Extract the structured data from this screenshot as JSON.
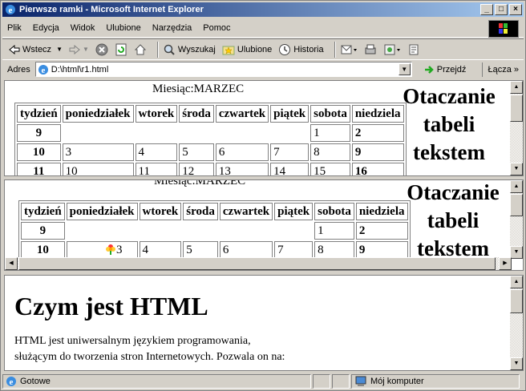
{
  "window": {
    "title": "Pierwsze ramki - Microsoft Internet Explorer",
    "min": "_",
    "max": "□",
    "close": "×"
  },
  "menu": [
    "Plik",
    "Edycja",
    "Widok",
    "Ulubione",
    "Narzędzia",
    "Pomoc"
  ],
  "toolbar": {
    "back": "Wstecz",
    "search": "Wyszukaj",
    "favorites": "Ulubione",
    "history": "Historia"
  },
  "address": {
    "label": "Adres",
    "value": "D:\\html\\r1.html",
    "go": "Przejdź",
    "links": "Łącza"
  },
  "calendar": {
    "caption": "Miesiąc:MARZEC",
    "headers": [
      "tydzień",
      "poniedziałek",
      "wtorek",
      "środa",
      "czwartek",
      "piątek",
      "sobota",
      "niedziela"
    ],
    "rows": [
      [
        "9",
        "",
        "",
        "",
        "",
        "",
        "1",
        "2"
      ],
      [
        "10",
        "3",
        "4",
        "5",
        "6",
        "7",
        "8",
        "9"
      ],
      [
        "11",
        "10",
        "11",
        "12",
        "13",
        "14",
        "15",
        "16"
      ]
    ]
  },
  "side_text": [
    "Otaczanie",
    "tabeli",
    "tekstem"
  ],
  "article": {
    "heading": "Czym jest HTML",
    "line1": "HTML jest uniwersalnym językiem programowania,",
    "line2": "służącym do tworzenia stron Internetowych. Pozwala on na:"
  },
  "status": {
    "text": "Gotowe",
    "zone": "Mój komputer"
  }
}
